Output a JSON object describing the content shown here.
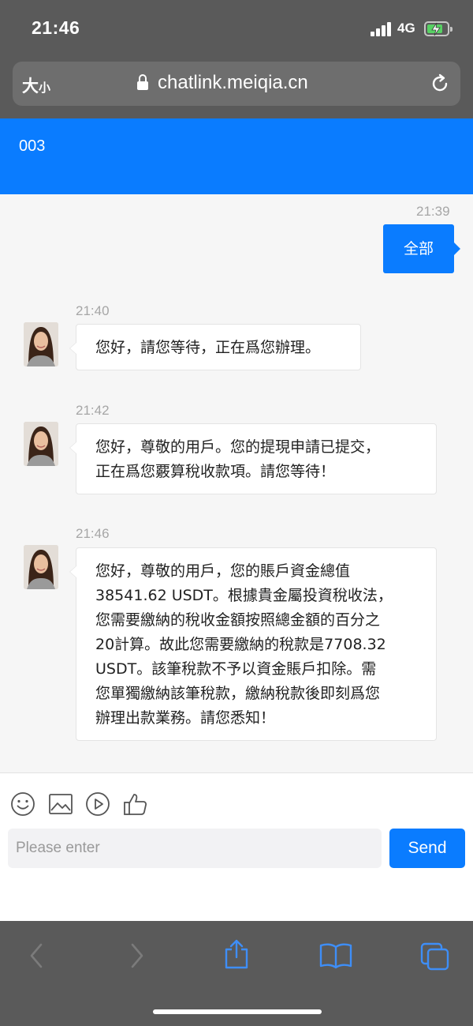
{
  "status_bar": {
    "time": "21:46",
    "network": "4G"
  },
  "browser": {
    "text_size_label": "大",
    "text_size_small": "小",
    "url": "chatlink.meiqia.cn"
  },
  "header": {
    "title": "003"
  },
  "messages": [
    {
      "time": "21:39",
      "from": "me",
      "text": "全部"
    },
    {
      "time": "21:40",
      "from": "agent",
      "lines": [
        "您好，請您等待，正在爲您辦理。"
      ]
    },
    {
      "time": "21:42",
      "from": "agent",
      "lines": [
        "您好，尊敬的用戶。您的提現申請已提交，",
        "正在爲您覈算稅收款項。請您等待！"
      ]
    },
    {
      "time": "21:46",
      "from": "agent",
      "lines": [
        "您好，尊敬的用戶，您的賬戶資金總值",
        "38541.62 USDT。根據貴金屬投資稅收法，",
        "您需要繳納的稅收金額按照總金額的百分之",
        "20計算。故此您需要繳納的稅款是7708.32",
        "USDT。該筆稅款不予以資金賬戶扣除。需",
        "您單獨繳納該筆稅款，繳納稅款後即刻爲您",
        "辦理出款業務。請您悉知！"
      ]
    }
  ],
  "composer": {
    "placeholder": "Please enter",
    "value": "",
    "send_label": "Send"
  },
  "colors": {
    "accent": "#0a7cff",
    "chrome": "#5a5a5a",
    "chat_bg": "#f6f6f6"
  }
}
